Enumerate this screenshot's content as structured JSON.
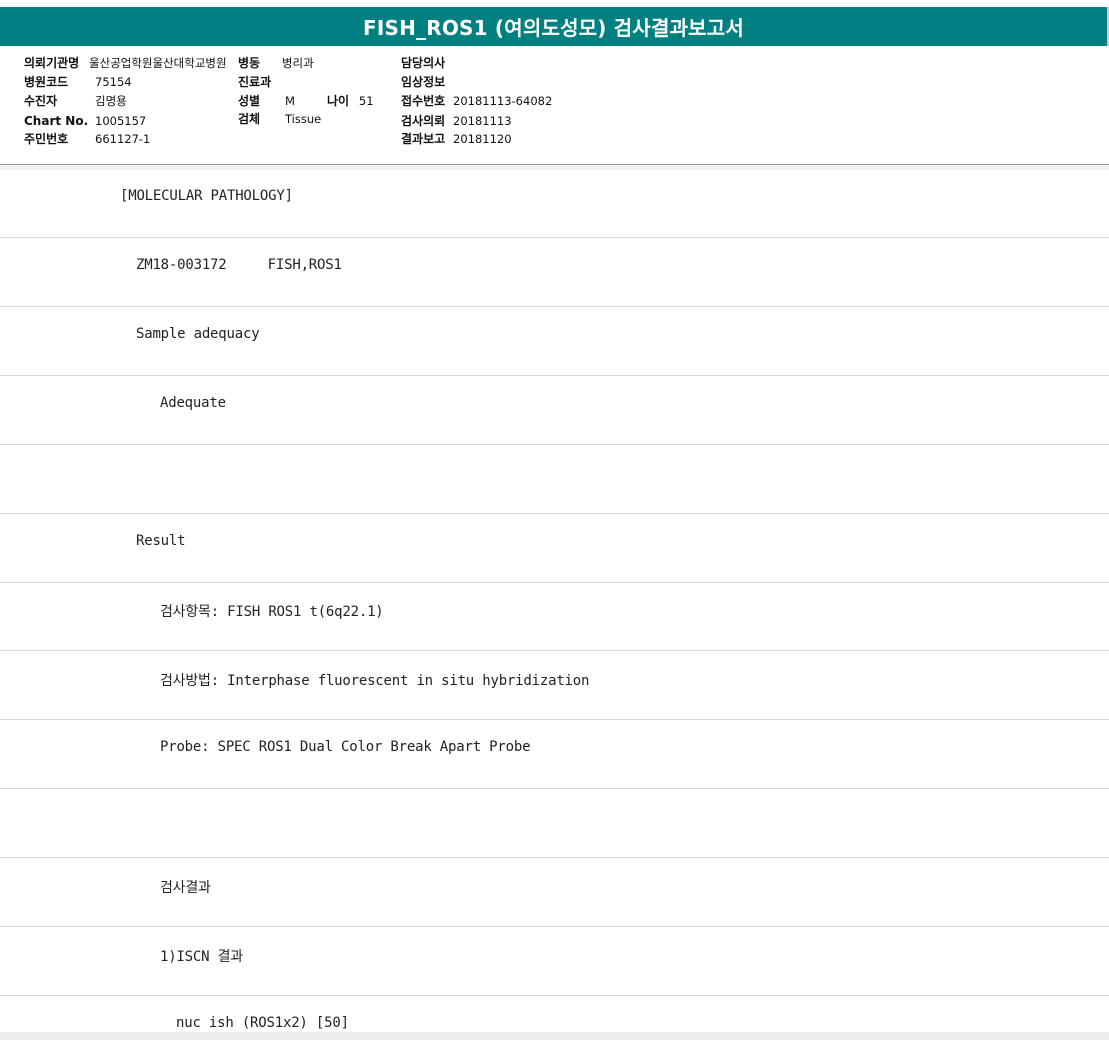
{
  "report": {
    "title": "FISH_ROS1 (여의도성모) 검사결과보고서"
  },
  "patient_info": {
    "institution_label": "의뢰기관명",
    "institution_value": "울산공업학원울산대학교병원",
    "ward_label": "병동",
    "ward_value": "병리과",
    "doctor_label": "담당의사",
    "doctor_value": "",
    "hospital_code_label": "병원코드",
    "hospital_code_value": "75154",
    "department_label": "진료과",
    "department_value": "",
    "clinical_info_label": "임상정보",
    "clinical_info_value": "",
    "recipient_label": "수진자",
    "recipient_value": "김명용",
    "sex_label": "성별",
    "sex_value": "M",
    "age_label": "나이",
    "age_value": "51",
    "receipt_no_label": "접수번호",
    "receipt_no_value": "20181113-64082",
    "chart_no_label": "Chart No.",
    "chart_no_value": "1005157",
    "specimen_label": "검체",
    "specimen_value": "Tissue",
    "request_date_label": "검사의뢰",
    "request_date_value": "20181113",
    "id_no_label": "주민번호",
    "id_no_value": "661127-1",
    "report_date_label": "결과보고",
    "report_date_value": "20181120"
  },
  "report_lines": [
    {
      "text": "[MOLECULAR PATHOLOGY]",
      "indent": 120
    },
    {
      "text": "ZM18-003172     FISH,ROS1",
      "indent": 136
    },
    {
      "text": "Sample adequacy",
      "indent": 136
    },
    {
      "text": "Adequate",
      "indent": 160
    },
    {
      "text": "",
      "indent": 136
    },
    {
      "text": "Result",
      "indent": 136
    },
    {
      "text": "검사항목: FISH ROS1 t(6q22.1)",
      "indent": 160
    },
    {
      "text": "검사방법: Interphase fluorescent in situ hybridization",
      "indent": 160
    },
    {
      "text": "Probe: SPEC ROS1 Dual Color Break Apart Probe",
      "indent": 160
    },
    {
      "text": "",
      "indent": 160
    },
    {
      "text": "검사결과",
      "indent": 160
    },
    {
      "text": "1)ISCN 결과",
      "indent": 160
    },
    {
      "text": "nuc ish (ROS1x2) [50]",
      "indent": 176
    }
  ],
  "colors": {
    "title_bar": "#008080",
    "title_text": "#ffffff"
  }
}
